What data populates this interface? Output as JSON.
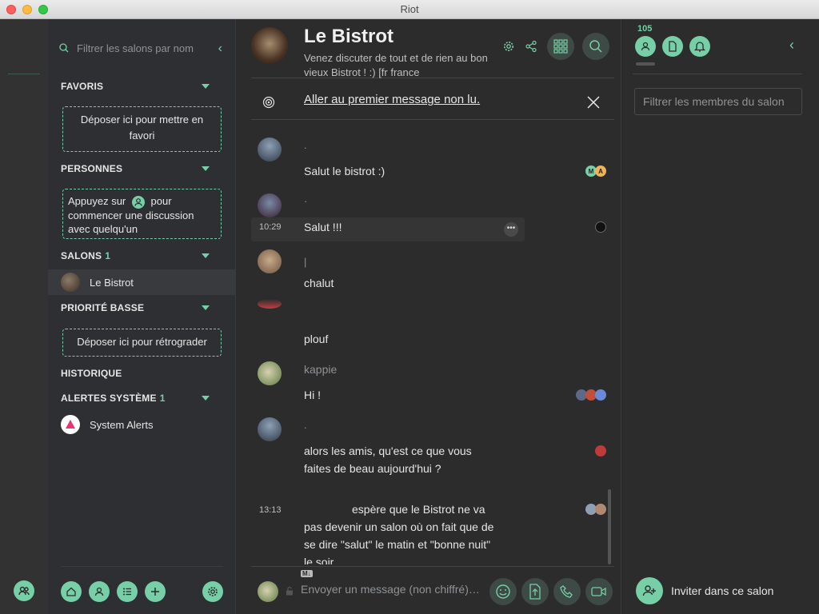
{
  "window": {
    "title": "Riot"
  },
  "sidebar": {
    "filter_placeholder": "Filtrer les salons par nom",
    "sections": {
      "favorites": {
        "label": "FAVORIS",
        "drop_text": "Déposer ici pour mettre en favori"
      },
      "people": {
        "label": "PERSONNES",
        "hint_before": "Appuyez sur",
        "hint_after": "pour commencer une discussion avec quelqu'un"
      },
      "rooms": {
        "label": "SALONS",
        "count": "1",
        "items": [
          {
            "name": "Le Bistrot"
          }
        ]
      },
      "low_priority": {
        "label": "PRIORITÉ BASSE",
        "drop_text": "Déposer ici pour rétrograder"
      },
      "history": {
        "label": "HISTORIQUE"
      },
      "system_alerts": {
        "label": "ALERTES SYSTÈME",
        "count": "1",
        "items": [
          {
            "name": "System Alerts"
          }
        ]
      }
    }
  },
  "room": {
    "name": "Le Bistrot",
    "topic": "Venez discuter de tout et de rien au bon vieux Bistrot ! :) [fr france",
    "unread_link": "Aller au premier message non lu."
  },
  "timeline": {
    "messages": [
      {
        "sender": ".",
        "body": "Salut le bistrot :)",
        "time": "",
        "receipts": [
          "M",
          "A"
        ]
      },
      {
        "sender": "·",
        "body": "Salut !!!",
        "time": "10:29",
        "receipts": [
          ""
        ]
      },
      {
        "sender": "|",
        "body": "chalut",
        "time": "",
        "receipts": []
      },
      {
        "sender": "",
        "body": "plouf",
        "time": "",
        "receipts": []
      },
      {
        "sender": "kappie",
        "body": "Hi !",
        "time": "",
        "receipts": [
          "",
          "",
          ""
        ]
      },
      {
        "sender": ".",
        "body": "alors les amis, qu'est ce que vous faites de beau aujourd'hui ?",
        "time": "",
        "receipts": [
          ""
        ]
      },
      {
        "sender": "",
        "body": "espère que le Bistrot ne va pas devenir un salon où on fait que de se dire \"salut\" le matin et \"bonne nuit\" le soir",
        "time": "13:13",
        "receipts": [
          "",
          ""
        ]
      }
    ]
  },
  "composer": {
    "placeholder": "Envoyer un message (non chiffré)…",
    "md_badge": "M↓"
  },
  "right_panel": {
    "member_count": "105",
    "member_filter_placeholder": "Filtrer les membres du salon",
    "invite_label": "Inviter dans ce salon"
  },
  "colors": {
    "accent": "#76cfa6",
    "background": "#2c2c2c",
    "sidebar": "#2e2f32"
  }
}
